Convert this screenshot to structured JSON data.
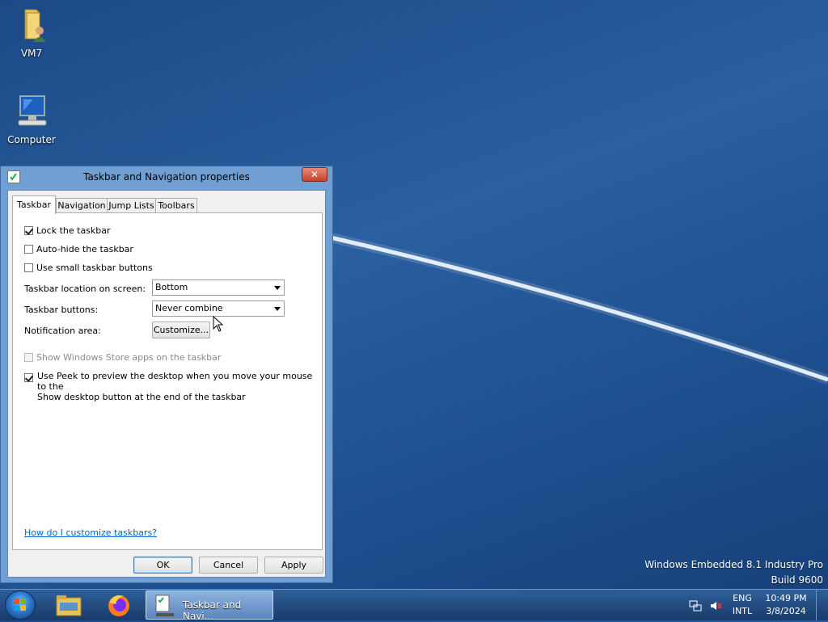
{
  "desktop": {
    "icons": [
      {
        "label": "VM7"
      },
      {
        "label": "Computer"
      }
    ],
    "watermark": {
      "line1": "Windows Embedded 8.1 Industry Pro",
      "line2": "Build 9600"
    }
  },
  "dialog": {
    "title": "Taskbar and Navigation properties",
    "close_label": "✕",
    "tabs": [
      {
        "label": "Taskbar",
        "active": true
      },
      {
        "label": "Navigation",
        "active": false
      },
      {
        "label": "Jump Lists",
        "active": false
      },
      {
        "label": "Toolbars",
        "active": false
      }
    ],
    "checkboxes": {
      "lock": {
        "label": "Lock the taskbar",
        "checked": true
      },
      "autohide": {
        "label": "Auto-hide the taskbar",
        "checked": false
      },
      "small": {
        "label": "Use small taskbar buttons",
        "checked": false
      },
      "store_apps": {
        "label": "Show Windows Store apps on the taskbar",
        "checked": false,
        "disabled": true
      },
      "peek_line1": "Use Peek to preview the desktop when you move your mouse to the",
      "peek_line2": "Show desktop button at the end of the taskbar",
      "peek_checked": true
    },
    "location": {
      "label": "Taskbar location on screen:",
      "value": "Bottom"
    },
    "buttons_combine": {
      "label": "Taskbar buttons:",
      "value": "Never combine"
    },
    "notification": {
      "label": "Notification area:",
      "button": "Customize..."
    },
    "help_link": "How do I customize taskbars?",
    "footer": {
      "ok": "OK",
      "cancel": "Cancel",
      "apply": "Apply"
    }
  },
  "taskbar": {
    "active_task": "Taskbar and Navi...",
    "language": {
      "line1": "ENG",
      "line2": "INTL"
    },
    "clock": {
      "time": "10:49 PM",
      "date": "3/8/2024"
    }
  },
  "colors": {
    "desktop": "#1d4f8f",
    "dialog_frame": "#6f9fd3",
    "link": "#0066cc",
    "close": "#c8412b"
  }
}
